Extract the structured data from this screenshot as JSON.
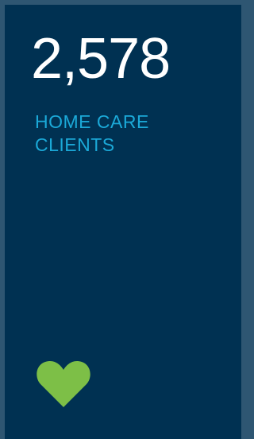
{
  "stat": {
    "value": "2,578",
    "label_line1": "HOME CARE",
    "label_line2": "CLIENTS"
  },
  "icon": {
    "name": "heart-icon",
    "color": "#7dbf47"
  },
  "colors": {
    "card_background": "#003152",
    "frame": "#2e5672",
    "number": "#ffffff",
    "label": "#1ba9d8"
  }
}
